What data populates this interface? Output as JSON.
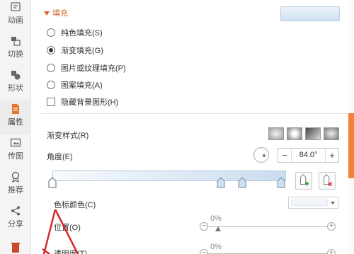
{
  "rail": {
    "items": [
      {
        "label": "动画",
        "icon": "animation-icon"
      },
      {
        "label": "切换",
        "icon": "transition-icon"
      },
      {
        "label": "形状",
        "icon": "shape-icon"
      },
      {
        "label": "属性",
        "icon": "properties-icon"
      },
      {
        "label": "传图",
        "icon": "upload-image-icon"
      },
      {
        "label": "推荐",
        "icon": "recommend-icon"
      },
      {
        "label": "分享",
        "icon": "share-icon"
      }
    ],
    "active": "属性"
  },
  "fill": {
    "title": "填充",
    "options": [
      {
        "label": "纯色填充(S)",
        "selected": false
      },
      {
        "label": "渐变填充(G)",
        "selected": true
      },
      {
        "label": "图片或纹理填充(P)",
        "selected": false
      },
      {
        "label": "图案填充(A)",
        "selected": false
      }
    ],
    "hide_bg_label": "隐藏背景图形(H)",
    "hide_bg_checked": false
  },
  "gradient": {
    "style_label": "渐变样式(R)",
    "angle_label": "角度(E)",
    "angle_value": "84.0°",
    "minus": "−",
    "plus": "+",
    "stop_color_label": "色标颜色(C)",
    "position_label": "位置(O)",
    "position_value": "0%",
    "transparency_label": "透明度(T)",
    "transparency_value": "0%"
  },
  "colors": {
    "accent": "#d0631f",
    "scroll_accent": "#f1813b",
    "gradient_start": "#f6fafd",
    "gradient_end": "#cbdcef",
    "annotation": "#d42a2a"
  }
}
